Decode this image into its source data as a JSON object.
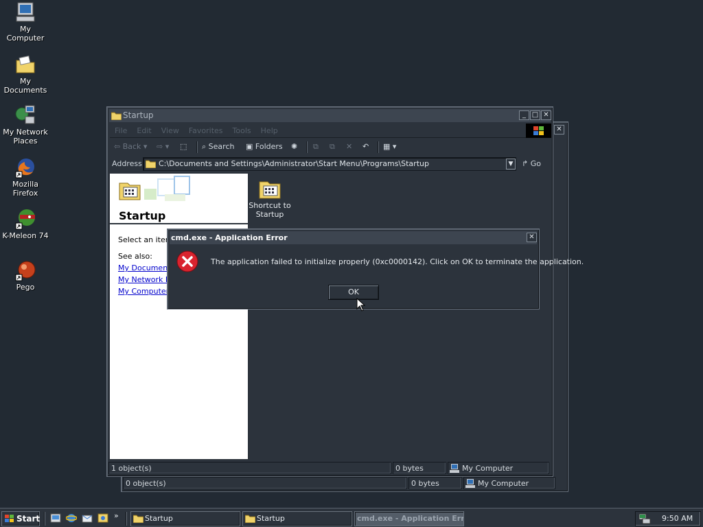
{
  "desktop": {
    "icons": [
      {
        "label": "My Computer",
        "icon": "computer-icon"
      },
      {
        "label": "My Documents",
        "icon": "documents-folder-icon"
      },
      {
        "label": "My Network Places",
        "icon": "network-places-icon"
      },
      {
        "label": "Mozilla Firefox",
        "icon": "firefox-icon"
      },
      {
        "label": "K-Meleon 74",
        "icon": "kmeleon-icon"
      },
      {
        "label": "Pego",
        "icon": "pego-icon"
      }
    ]
  },
  "explorer": {
    "title": "Startup",
    "menu": [
      "File",
      "Edit",
      "View",
      "Favorites",
      "Tools",
      "Help"
    ],
    "toolbar": {
      "back": "Back",
      "search": "Search",
      "folders": "Folders"
    },
    "address": {
      "label": "Address",
      "value": "C:\\Documents and Settings\\Administrator\\Start Menu\\Programs\\Startup",
      "go": "Go"
    },
    "panel": {
      "heading": "Startup",
      "description": "Select an item to view its description.",
      "see_also": "See also:",
      "links": [
        "My Documents",
        "My Network Places",
        "My Computer"
      ]
    },
    "files": [
      {
        "name": "Shortcut to Startup",
        "icon": "shortcut-folder-icon"
      }
    ],
    "status": {
      "objects": "1 object(s)",
      "size": "0 bytes",
      "zone": "My Computer"
    }
  },
  "back_window": {
    "status": {
      "objects": "0 object(s)",
      "size": "0 bytes",
      "zone": "My Computer"
    }
  },
  "dialog": {
    "title": "cmd.exe - Application Error",
    "message": "The application failed to initialize properly (0xc0000142). Click on OK to terminate the application.",
    "ok": "OK",
    "icon": "error-icon"
  },
  "taskbar": {
    "start": "Start",
    "quicklaunch": [
      "show-desktop-icon",
      "internet-explorer-icon",
      "outlook-express-icon",
      "media-icon"
    ],
    "tasks": [
      {
        "label": "Startup",
        "active": false
      },
      {
        "label": "Startup",
        "active": false
      },
      {
        "label": "cmd.exe - Application Error",
        "active": true
      }
    ],
    "clock": "9:50 AM"
  },
  "colors": {
    "desktop": "#222a33",
    "window": "#2c333c",
    "link": "#0000cc",
    "error": "#d9232e"
  }
}
